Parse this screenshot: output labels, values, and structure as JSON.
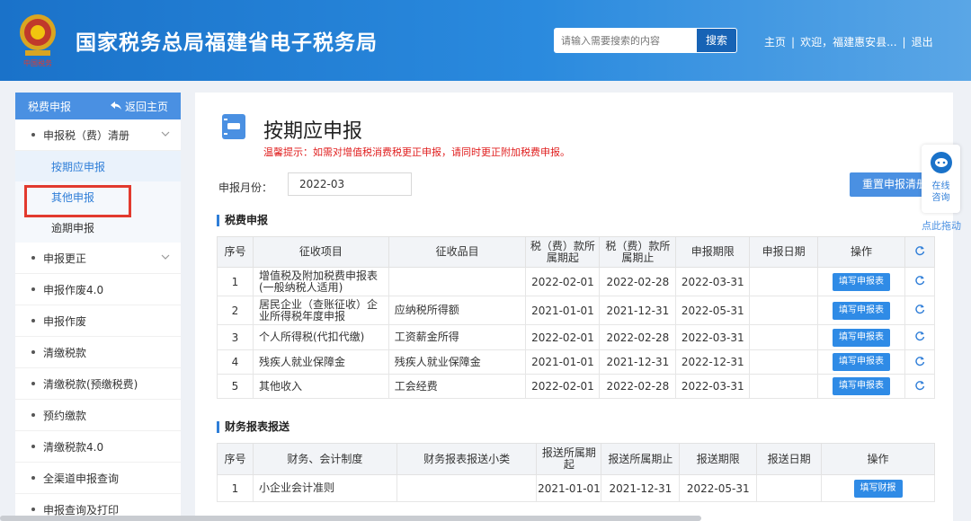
{
  "header": {
    "title": "国家税务总局福建省电子税务局",
    "emblem_text": "中国税务",
    "search_placeholder": "请输入需要搜索的内容",
    "search_button": "搜索",
    "nav_home": "主页",
    "nav_welcome": "欢迎，福建惠安县...",
    "nav_logout": "退出"
  },
  "sidebar": {
    "head_title": "税费申报",
    "back_label": "返回主页",
    "items": [
      {
        "label": "申报税（费）清册"
      },
      {
        "label": "申报更正"
      },
      {
        "label": "申报作废4.0"
      },
      {
        "label": "申报作废"
      },
      {
        "label": "清缴税款"
      },
      {
        "label": "清缴税款(预缴税费)"
      },
      {
        "label": "预约缴款"
      },
      {
        "label": "清缴税款4.0"
      },
      {
        "label": "全渠道申报查询"
      },
      {
        "label": "申报查询及打印"
      }
    ],
    "sub_items": [
      {
        "label": "按期应申报"
      },
      {
        "label": "其他申报"
      },
      {
        "label": "逾期申报"
      }
    ]
  },
  "main": {
    "title": "按期应申报",
    "tip": "温馨提示：如需对增值税消费税更正申报，请同时更正附加税费申报。",
    "period_label": "申报月份：",
    "period_value": "2022-03",
    "reset_button": "重置申报清册",
    "tax_section": "税费申报",
    "tax_headers": [
      "序号",
      "征收项目",
      "征收品目",
      "税（费）款所属期起",
      "税（费）款所属期止",
      "申报期限",
      "申报日期",
      "操作"
    ],
    "tax_rows": [
      {
        "no": "1",
        "item": "增值税及附加税费申报表(一般纳税人适用)",
        "sub": "",
        "start": "2022-02-01",
        "end": "2022-02-28",
        "deadline": "2022-03-31",
        "date": "",
        "action": "填写申报表"
      },
      {
        "no": "2",
        "item": "居民企业（查账征收）企业所得税年度申报",
        "sub": "应纳税所得额",
        "start": "2021-01-01",
        "end": "2021-12-31",
        "deadline": "2022-05-31",
        "date": "",
        "action": "填写申报表"
      },
      {
        "no": "3",
        "item": "个人所得税(代扣代缴)",
        "sub": "工资薪金所得",
        "start": "2022-02-01",
        "end": "2022-02-28",
        "deadline": "2022-03-31",
        "date": "",
        "action": "填写申报表"
      },
      {
        "no": "4",
        "item": "残疾人就业保障金",
        "sub": "残疾人就业保障金",
        "start": "2021-01-01",
        "end": "2021-12-31",
        "deadline": "2022-12-31",
        "date": "",
        "action": "填写申报表"
      },
      {
        "no": "5",
        "item": "其他收入",
        "sub": "工会经费",
        "start": "2022-02-01",
        "end": "2022-02-28",
        "deadline": "2022-03-31",
        "date": "",
        "action": "填写申报表"
      }
    ],
    "fin_section": "财务报表报送",
    "fin_headers": [
      "序号",
      "财务、会计制度",
      "财务报表报送小类",
      "报送所属期起",
      "报送所属期止",
      "报送期限",
      "报送日期",
      "操作"
    ],
    "fin_rows": [
      {
        "no": "1",
        "system": "小企业会计准则",
        "sub": "",
        "start": "2021-01-01",
        "end": "2021-12-31",
        "deadline": "2022-05-31",
        "date": "",
        "action": "填写财报"
      }
    ]
  },
  "float": {
    "consult_label_1": "在线",
    "consult_label_2": "咨询",
    "drag_hint": "点此拖动"
  }
}
